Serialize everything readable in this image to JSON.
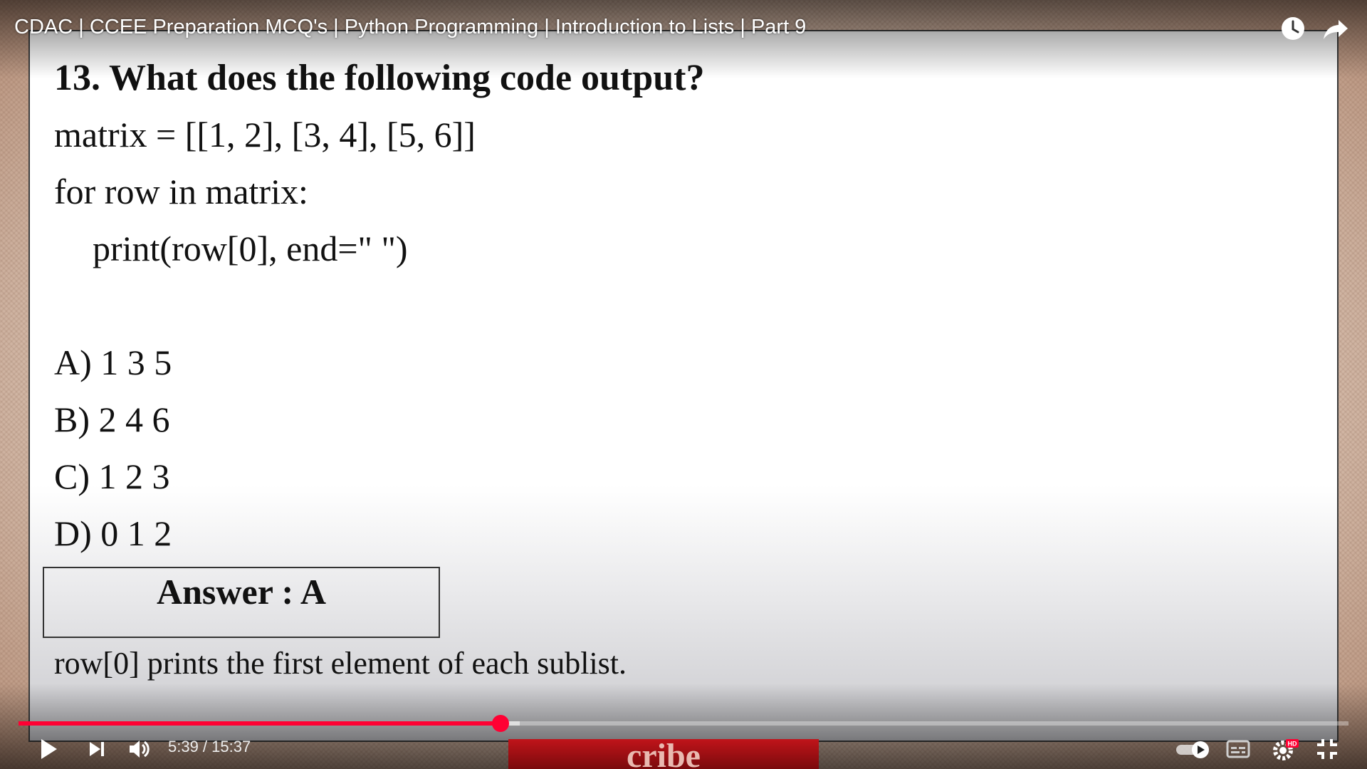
{
  "player": {
    "title": "CDAC | CCEE Preparation MCQ's | Python Programming | Introduction to Lists | Part 9",
    "time": "5:39 / 15:37",
    "progress_fraction": 0.3625,
    "buffer_fraction": 0.377,
    "banner_text": "cribe",
    "accent_color": "#ff0033",
    "icons": [
      "watch-later-icon",
      "share-icon",
      "play-icon",
      "next-icon",
      "volume-icon",
      "autoplay-toggle-icon",
      "subtitles-icon",
      "settings-icon",
      "fullscreen-exit-icon"
    ],
    "settings_badge": "HD"
  },
  "slide": {
    "question": "13. What does the following code output?",
    "code_lines": [
      "matrix = [[1, 2], [3, 4], [5, 6]]",
      "for row in matrix:",
      "print(row[0], end=\" \")"
    ],
    "options": [
      "A) 1 3 5",
      "B) 2 4 6",
      "C) 1 2 3",
      "D) 0 1 2"
    ],
    "answer": "Answer : A",
    "explanation": "row[0] prints the first element of each sublist."
  }
}
